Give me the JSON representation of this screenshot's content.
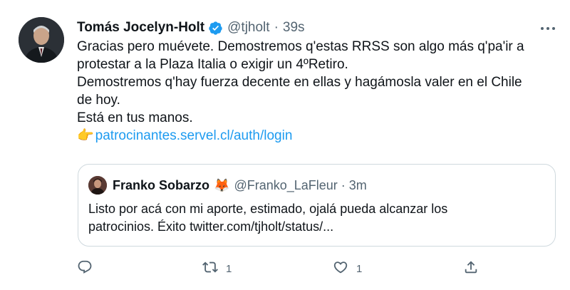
{
  "tweet": {
    "author_name": "Tomás Jocelyn-Holt",
    "handle": "@tjholt",
    "separator": "·",
    "time": "39s",
    "lines": [
      "Gracias pero muévete. Demostremos q'estas RRSS son algo más q'pa'ir a",
      "protestar a la Plaza Italia o exigir un 4ºRetiro.",
      "Demostremos q'hay fuerza decente en ellas y hagámosla valer en el Chile",
      "de hoy.",
      "Está en tus manos."
    ],
    "link_emoji": "👉",
    "link_text": "patrocinantes.servel.cl/auth/login"
  },
  "quoted": {
    "author_name": "Franko Sobarzo",
    "emoji": "🦊",
    "handle": "@Franko_LaFleur",
    "separator": "·",
    "time": "3m",
    "lines": [
      "Listo por acá con mi aporte, estimado, ojalá pueda alcanzar los",
      "patrocinios. Éxito twitter.com/tjholt/status/..."
    ]
  },
  "actions": {
    "reply_count": "",
    "retweet_count": "1",
    "like_count": "1",
    "share_count": ""
  },
  "icons": {
    "verified": "verified-badge-icon",
    "more": "more-horizontal-icon",
    "reply": "reply-bubble-icon",
    "retweet": "retweet-icon",
    "like": "heart-icon",
    "share": "share-upload-icon"
  },
  "colors": {
    "verified": "#1d9bf0",
    "link": "#1d9bf0",
    "secondary_text": "#536471",
    "border": "#cfd9de"
  }
}
